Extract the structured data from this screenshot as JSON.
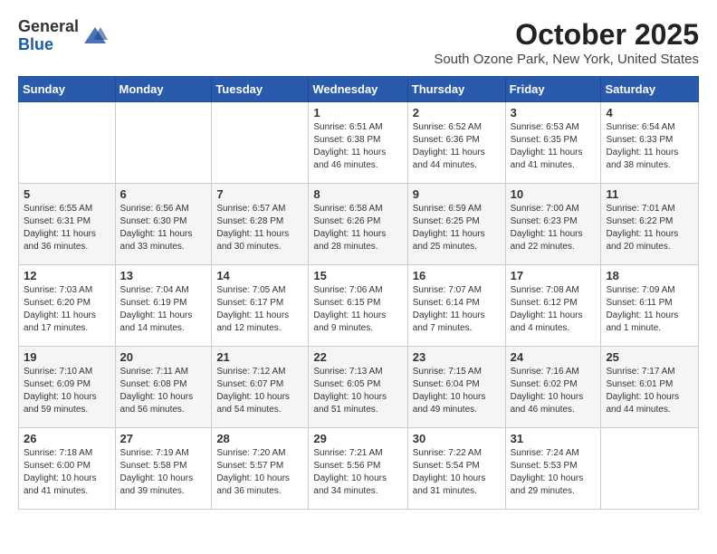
{
  "header": {
    "logo_general": "General",
    "logo_blue": "Blue",
    "month": "October 2025",
    "location": "South Ozone Park, New York, United States"
  },
  "weekdays": [
    "Sunday",
    "Monday",
    "Tuesday",
    "Wednesday",
    "Thursday",
    "Friday",
    "Saturday"
  ],
  "weeks": [
    [
      {
        "day": "",
        "info": ""
      },
      {
        "day": "",
        "info": ""
      },
      {
        "day": "",
        "info": ""
      },
      {
        "day": "1",
        "info": "Sunrise: 6:51 AM\nSunset: 6:38 PM\nDaylight: 11 hours\nand 46 minutes."
      },
      {
        "day": "2",
        "info": "Sunrise: 6:52 AM\nSunset: 6:36 PM\nDaylight: 11 hours\nand 44 minutes."
      },
      {
        "day": "3",
        "info": "Sunrise: 6:53 AM\nSunset: 6:35 PM\nDaylight: 11 hours\nand 41 minutes."
      },
      {
        "day": "4",
        "info": "Sunrise: 6:54 AM\nSunset: 6:33 PM\nDaylight: 11 hours\nand 38 minutes."
      }
    ],
    [
      {
        "day": "5",
        "info": "Sunrise: 6:55 AM\nSunset: 6:31 PM\nDaylight: 11 hours\nand 36 minutes."
      },
      {
        "day": "6",
        "info": "Sunrise: 6:56 AM\nSunset: 6:30 PM\nDaylight: 11 hours\nand 33 minutes."
      },
      {
        "day": "7",
        "info": "Sunrise: 6:57 AM\nSunset: 6:28 PM\nDaylight: 11 hours\nand 30 minutes."
      },
      {
        "day": "8",
        "info": "Sunrise: 6:58 AM\nSunset: 6:26 PM\nDaylight: 11 hours\nand 28 minutes."
      },
      {
        "day": "9",
        "info": "Sunrise: 6:59 AM\nSunset: 6:25 PM\nDaylight: 11 hours\nand 25 minutes."
      },
      {
        "day": "10",
        "info": "Sunrise: 7:00 AM\nSunset: 6:23 PM\nDaylight: 11 hours\nand 22 minutes."
      },
      {
        "day": "11",
        "info": "Sunrise: 7:01 AM\nSunset: 6:22 PM\nDaylight: 11 hours\nand 20 minutes."
      }
    ],
    [
      {
        "day": "12",
        "info": "Sunrise: 7:03 AM\nSunset: 6:20 PM\nDaylight: 11 hours\nand 17 minutes."
      },
      {
        "day": "13",
        "info": "Sunrise: 7:04 AM\nSunset: 6:19 PM\nDaylight: 11 hours\nand 14 minutes."
      },
      {
        "day": "14",
        "info": "Sunrise: 7:05 AM\nSunset: 6:17 PM\nDaylight: 11 hours\nand 12 minutes."
      },
      {
        "day": "15",
        "info": "Sunrise: 7:06 AM\nSunset: 6:15 PM\nDaylight: 11 hours\nand 9 minutes."
      },
      {
        "day": "16",
        "info": "Sunrise: 7:07 AM\nSunset: 6:14 PM\nDaylight: 11 hours\nand 7 minutes."
      },
      {
        "day": "17",
        "info": "Sunrise: 7:08 AM\nSunset: 6:12 PM\nDaylight: 11 hours\nand 4 minutes."
      },
      {
        "day": "18",
        "info": "Sunrise: 7:09 AM\nSunset: 6:11 PM\nDaylight: 11 hours\nand 1 minute."
      }
    ],
    [
      {
        "day": "19",
        "info": "Sunrise: 7:10 AM\nSunset: 6:09 PM\nDaylight: 10 hours\nand 59 minutes."
      },
      {
        "day": "20",
        "info": "Sunrise: 7:11 AM\nSunset: 6:08 PM\nDaylight: 10 hours\nand 56 minutes."
      },
      {
        "day": "21",
        "info": "Sunrise: 7:12 AM\nSunset: 6:07 PM\nDaylight: 10 hours\nand 54 minutes."
      },
      {
        "day": "22",
        "info": "Sunrise: 7:13 AM\nSunset: 6:05 PM\nDaylight: 10 hours\nand 51 minutes."
      },
      {
        "day": "23",
        "info": "Sunrise: 7:15 AM\nSunset: 6:04 PM\nDaylight: 10 hours\nand 49 minutes."
      },
      {
        "day": "24",
        "info": "Sunrise: 7:16 AM\nSunset: 6:02 PM\nDaylight: 10 hours\nand 46 minutes."
      },
      {
        "day": "25",
        "info": "Sunrise: 7:17 AM\nSunset: 6:01 PM\nDaylight: 10 hours\nand 44 minutes."
      }
    ],
    [
      {
        "day": "26",
        "info": "Sunrise: 7:18 AM\nSunset: 6:00 PM\nDaylight: 10 hours\nand 41 minutes."
      },
      {
        "day": "27",
        "info": "Sunrise: 7:19 AM\nSunset: 5:58 PM\nDaylight: 10 hours\nand 39 minutes."
      },
      {
        "day": "28",
        "info": "Sunrise: 7:20 AM\nSunset: 5:57 PM\nDaylight: 10 hours\nand 36 minutes."
      },
      {
        "day": "29",
        "info": "Sunrise: 7:21 AM\nSunset: 5:56 PM\nDaylight: 10 hours\nand 34 minutes."
      },
      {
        "day": "30",
        "info": "Sunrise: 7:22 AM\nSunset: 5:54 PM\nDaylight: 10 hours\nand 31 minutes."
      },
      {
        "day": "31",
        "info": "Sunrise: 7:24 AM\nSunset: 5:53 PM\nDaylight: 10 hours\nand 29 minutes."
      },
      {
        "day": "",
        "info": ""
      }
    ]
  ]
}
